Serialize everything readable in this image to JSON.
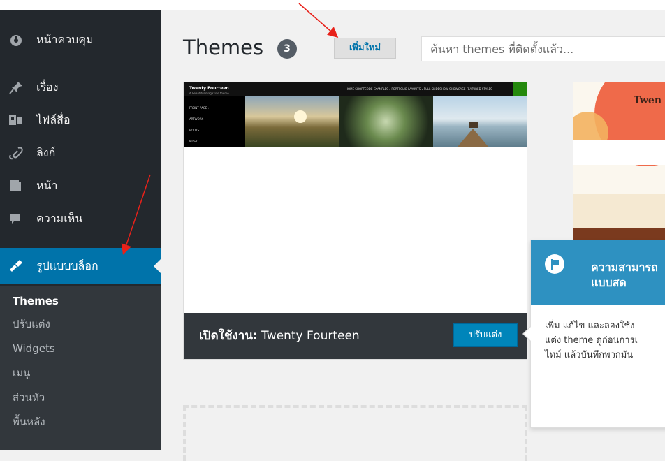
{
  "colors": {
    "sidebar_bg": "#23282d",
    "submenu_bg": "#32373c",
    "accent": "#0073aa",
    "content_bg": "#f1f1f1",
    "annotation": "#e8211a"
  },
  "sidebar": {
    "items": [
      {
        "label": "หน้าควบคุม",
        "icon": "dashboard-icon"
      },
      {
        "label": "เรื่อง",
        "icon": "pin-icon"
      },
      {
        "label": "ไฟล์สื่อ",
        "icon": "media-icon"
      },
      {
        "label": "ลิงก์",
        "icon": "link-icon"
      },
      {
        "label": "หน้า",
        "icon": "page-icon"
      },
      {
        "label": "ความเห็น",
        "icon": "comment-icon"
      },
      {
        "label": "รูปแบบบล็อก",
        "icon": "appearance-icon",
        "current": true
      }
    ],
    "submenu": [
      "Themes",
      "ปรับแต่ง",
      "Widgets",
      "เมนู",
      "ส่วนหัว",
      "พื้นหลัง"
    ]
  },
  "header": {
    "title": "Themes",
    "count": "3",
    "add_new_label": "เพิ่มใหม่",
    "search_placeholder": "ค้นหา themes ที่ติดตั้งแล้ว..."
  },
  "themes": [
    {
      "name": "Twenty Fourteen",
      "active_prefix": "เปิดใช้งาน:",
      "customize_label": "ปรับแต่ง",
      "screenshot": {
        "site_title": "Twenty Fourteen",
        "tagline": "A beautiful magazine theme",
        "menu": "HOME   SHORTCODE EXAMPLES ▾   PORTFOLIO LAYOUTS ▾   FULL SLIDESHOW   SHOWCASE FEATURED STYLES",
        "side_links": [
          "FRONT PAGE ›",
          "ARTWORK",
          "BOOKS",
          "MUSIC"
        ]
      }
    },
    {
      "name_partial": "Twen"
    }
  ],
  "pointer": {
    "title": "ความสามารถ แบบสด",
    "body_lines": [
      "เพิ่ม แก้ไข และลองใช้ง",
      "แต่ง theme ดูก่อนการเ",
      "ไทม์ แล้วบันทึกพวกมัน"
    ],
    "icon": "flag-icon"
  }
}
